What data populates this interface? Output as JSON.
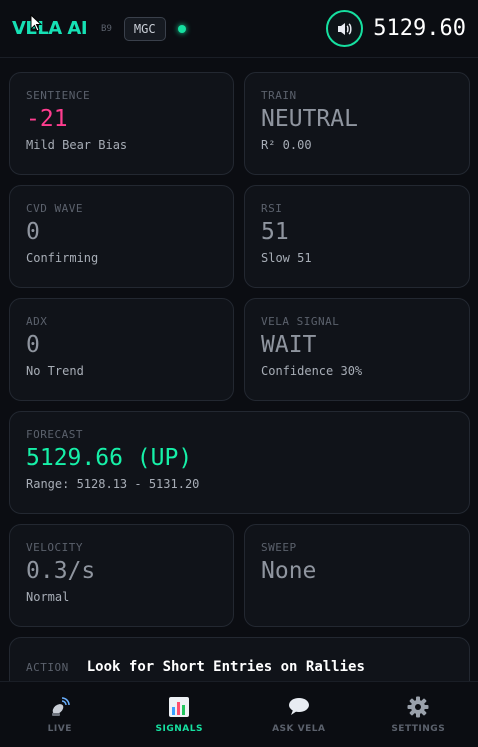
{
  "header": {
    "logo": "VELA AI",
    "version": "B9",
    "ticker": "MGC",
    "price": "5129.60",
    "accent_color": "#16e0a0",
    "sound_icon": "speaker-icon"
  },
  "cards": {
    "sentience": {
      "label": "SENTIENCE",
      "value": "-21",
      "sub": "Mild Bear Bias"
    },
    "train": {
      "label": "TRAIN",
      "value": "NEUTRAL",
      "sub": "R² 0.00"
    },
    "cvd": {
      "label": "CVD WAVE",
      "value": "0",
      "sub": "Confirming"
    },
    "rsi": {
      "label": "RSI",
      "value": "51",
      "sub": "Slow 51"
    },
    "adx": {
      "label": "ADX",
      "value": "0",
      "sub": "No Trend"
    },
    "signal": {
      "label": "VELA SIGNAL",
      "value": "WAIT",
      "sub": "Confidence 30%"
    },
    "forecast": {
      "label": "FORECAST",
      "value": "5129.66 (UP)",
      "sub": "Range: 5128.13 - 5131.20"
    },
    "velocity": {
      "label": "VELOCITY",
      "value": "0.3/s",
      "sub": "Normal"
    },
    "sweep": {
      "label": "SWEEP",
      "value": "None"
    }
  },
  "action": {
    "label": "ACTION",
    "text": "Look for Short Entries on Rallies"
  },
  "nav": {
    "live": "LIVE",
    "signals": "SIGNALS",
    "ask": "ASK VELA",
    "settings": "SETTINGS"
  }
}
